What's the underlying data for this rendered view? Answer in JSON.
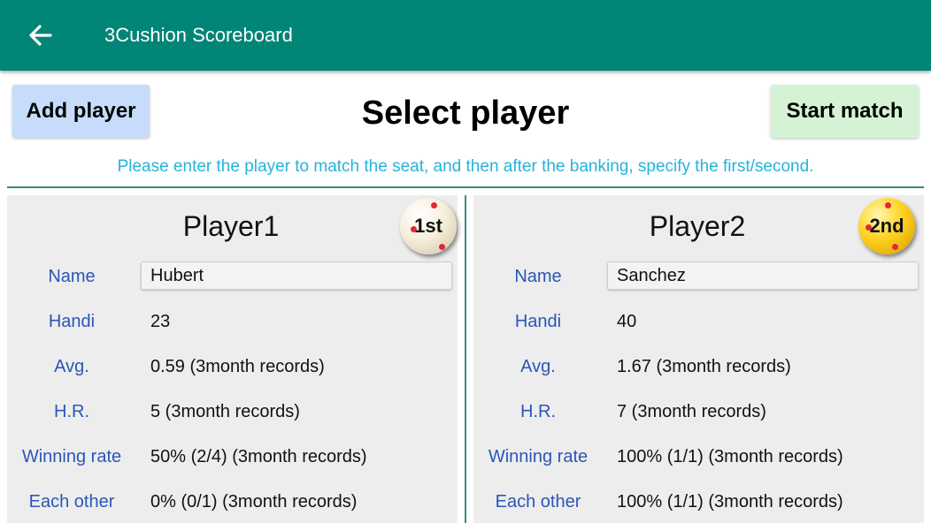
{
  "app": {
    "title": "3Cushion Scoreboard",
    "accent_color": "#008577"
  },
  "toolbar": {
    "back_icon": "arrow-left-icon",
    "add_player_label": "Add player",
    "start_match_label": "Start match"
  },
  "page": {
    "title": "Select player",
    "instruction": "Please enter the player to match the seat, and then after the banking, specify the first/second."
  },
  "labels": {
    "name": "Name",
    "handi": "Handi",
    "avg": "Avg.",
    "hr": "H.R.",
    "winning_rate": "Winning rate",
    "each_other": "Each other"
  },
  "players": [
    {
      "title": "Player1",
      "order_badge": "1st",
      "ball_color": "#f7efdc",
      "name": "Hubert",
      "handi": "23",
      "avg": "0.59 (3month records)",
      "hr": "5 (3month records)",
      "winning_rate": "50% (2/4) (3month records)",
      "each_other": "0% (0/1) (3month records)"
    },
    {
      "title": "Player2",
      "order_badge": "2nd",
      "ball_color": "#ffd21f",
      "name": "Sanchez",
      "handi": "40",
      "avg": "1.67 (3month records)",
      "hr": "7 (3month records)",
      "winning_rate": "100% (1/1) (3month records)",
      "each_other": "100% (1/1) (3month records)"
    }
  ]
}
